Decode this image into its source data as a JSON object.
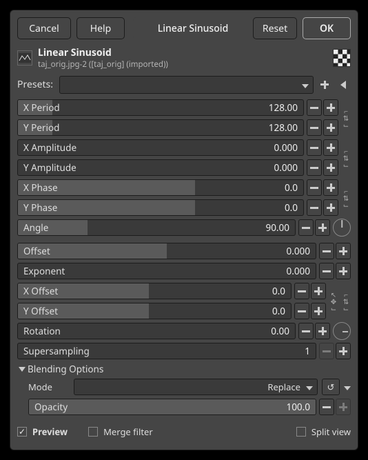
{
  "buttons": {
    "cancel": "Cancel",
    "help": "Help",
    "reset": "Reset",
    "ok": "OK"
  },
  "header": {
    "title": "Linear Sinusoid",
    "name": "Linear Sinusoid",
    "sub": "taj_orig.jpg-2 ([taj_orig] (imported))"
  },
  "presets_label": "Presets:",
  "params": {
    "x_period": {
      "label": "X Period",
      "value": "128.00",
      "fill": 12
    },
    "y_period": {
      "label": "Y Period",
      "value": "128.00",
      "fill": 12
    },
    "x_amplitude": {
      "label": "X Amplitude",
      "value": "0.000",
      "fill": 0
    },
    "y_amplitude": {
      "label": "Y Amplitude",
      "value": "0.000",
      "fill": 0
    },
    "x_phase": {
      "label": "X Phase",
      "value": "0.0",
      "fill": 62
    },
    "y_phase": {
      "label": "Y Phase",
      "value": "0.0",
      "fill": 62
    },
    "angle": {
      "label": "Angle",
      "value": "90.00",
      "fill": 25
    },
    "offset": {
      "label": "Offset",
      "value": "0.000",
      "fill": 50
    },
    "exponent": {
      "label": "Exponent",
      "value": "0.000",
      "fill": 0
    },
    "x_offset": {
      "label": "X Offset",
      "value": "0.0",
      "fill": 48
    },
    "y_offset": {
      "label": "Y Offset",
      "value": "0.0",
      "fill": 48
    },
    "rotation": {
      "label": "Rotation",
      "value": "0.00",
      "fill": 0
    },
    "supersampling": {
      "label": "Supersampling",
      "value": "1",
      "fill": 0
    }
  },
  "blend": {
    "header": "Blending Options",
    "mode_label": "Mode",
    "mode_value": "Replace",
    "opacity_label": "Opacity",
    "opacity_value": "100.0"
  },
  "foot": {
    "preview": "Preview",
    "merge": "Merge filter",
    "split": "Split view"
  }
}
